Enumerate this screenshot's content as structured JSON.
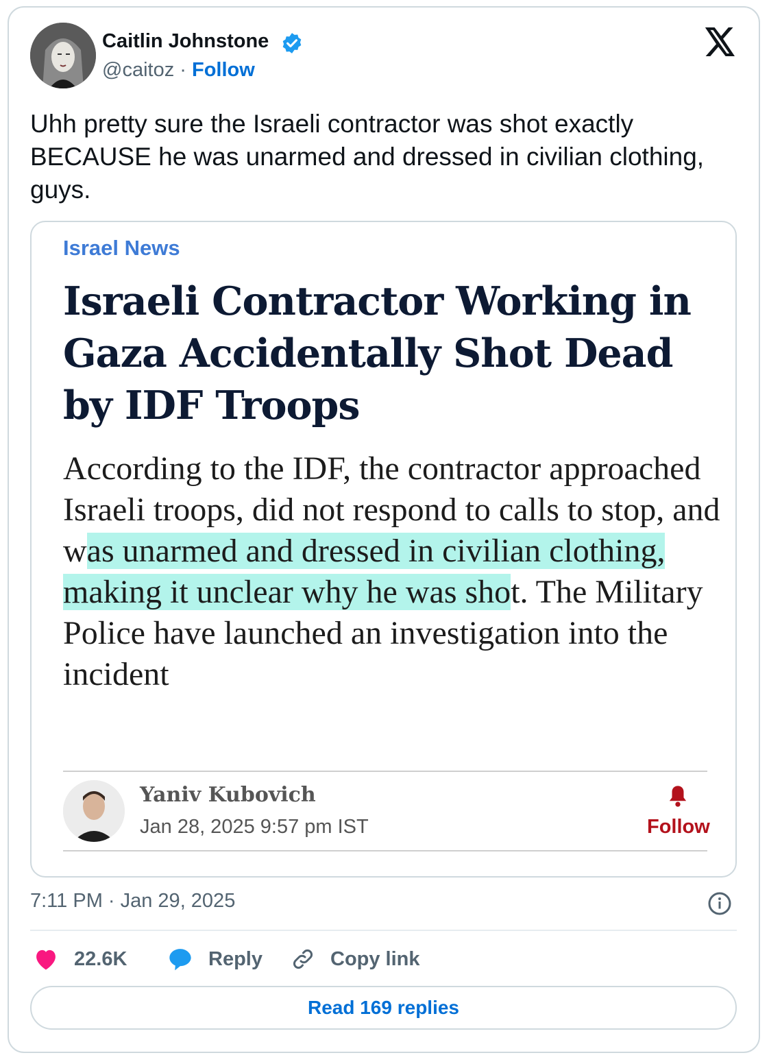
{
  "tweet": {
    "author_name": "Caitlin Johnstone",
    "handle": "@caitoz",
    "separator": "·",
    "follow_label": "Follow",
    "text": "Uhh pretty sure the Israeli contractor was shot exactly BECAUSE he was unarmed and dressed in civilian clothing, guys.",
    "timestamp": "7:11 PM · Jan 29, 2025"
  },
  "embed": {
    "section": "Israel News",
    "headline": "Israeli Contractor Working in Gaza Accidentally Shot Dead by IDF Troops",
    "summary_before": "According to the IDF, the contractor approached Israeli troops, did not respond to calls to stop, and w",
    "summary_highlight": "as unarmed and dressed in civilian clothing, making it unclear why he was sho",
    "summary_after": "t. The Military Police have launched an investigation into the incident",
    "highlight_color": "#56e6d2",
    "reporter_name": "Yaniv Kubovich",
    "reporter_date": "Jan 28, 2025 9:57 pm IST",
    "reporter_follow": "Follow",
    "accent_color": "#b3121c"
  },
  "actions": {
    "likes_count": "22.6K",
    "reply_label": "Reply",
    "copy_label": "Copy link",
    "read_replies": "Read 169 replies"
  },
  "icons": [
    "avatar",
    "verified-badge-icon",
    "x-logo-icon",
    "bell-icon",
    "info-icon",
    "heart-icon",
    "reply-bubble-icon",
    "link-icon"
  ],
  "colors": {
    "link_blue": "#006fd6",
    "like_pink": "#f91880",
    "reply_blue": "#1d9bf0",
    "section_blue": "#3e7bd6"
  }
}
